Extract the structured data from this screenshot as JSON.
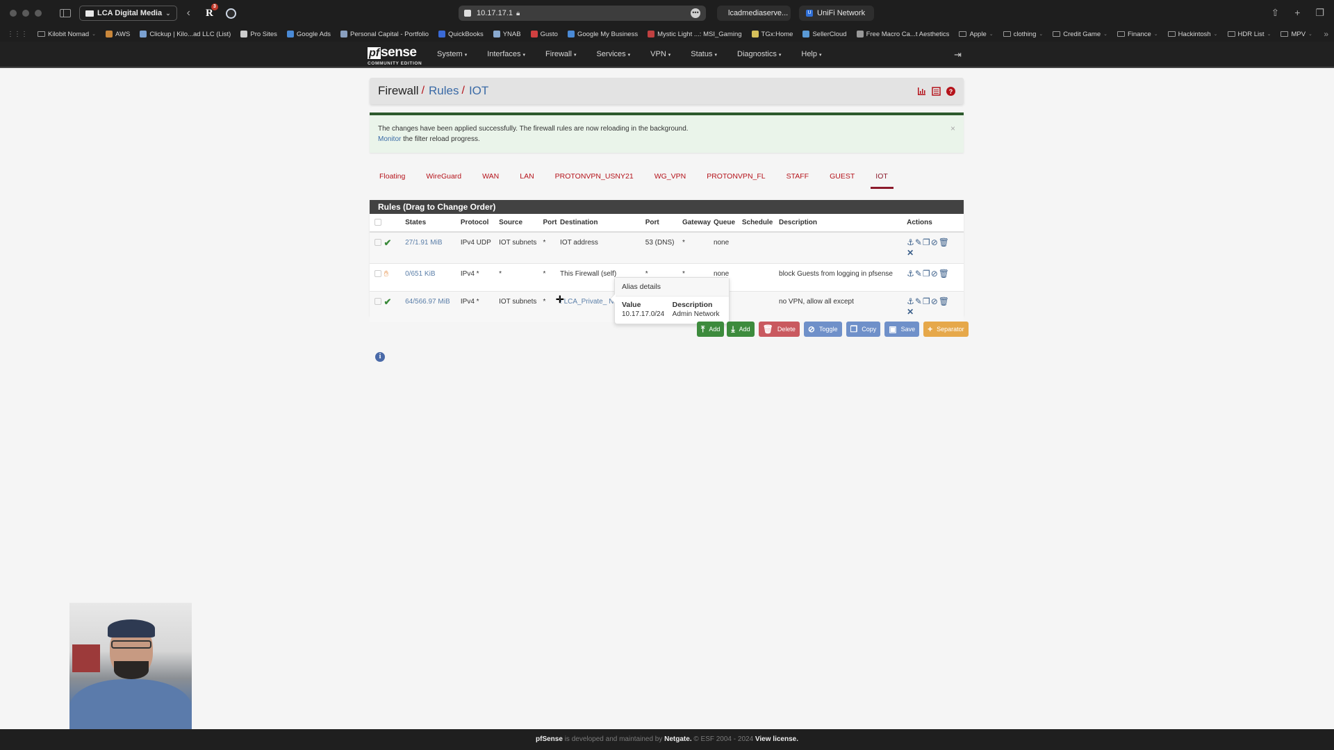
{
  "browser": {
    "profile": "LCA Digital Media",
    "ext_badge": "3",
    "url": "10.17.17.1",
    "tabs": [
      "lcadmediaserve...",
      "UniFi Network"
    ],
    "bookmarks": [
      {
        "label": "Kilobit Nomad",
        "folder": true
      },
      {
        "label": "AWS",
        "folder": false
      },
      {
        "label": "Clickup | Kilo...ad LLC (List)",
        "folder": false
      },
      {
        "label": "Pro Sites",
        "folder": false
      },
      {
        "label": "Google Ads",
        "folder": false
      },
      {
        "label": "Personal Capital - Portfolio",
        "folder": false
      },
      {
        "label": "QuickBooks",
        "folder": false
      },
      {
        "label": "YNAB",
        "folder": false
      },
      {
        "label": "Gusto",
        "folder": false
      },
      {
        "label": "Google My Business",
        "folder": false
      },
      {
        "label": "Mystic Light ...: MSI_Gaming",
        "folder": false
      },
      {
        "label": "TGx:Home",
        "folder": false
      },
      {
        "label": "SellerCloud",
        "folder": false
      },
      {
        "label": "Free Macro Ca...t Aesthetics",
        "folder": false
      },
      {
        "label": "Apple",
        "folder": true
      },
      {
        "label": "clothing",
        "folder": true
      },
      {
        "label": "Credit Game",
        "folder": true
      },
      {
        "label": "Finance",
        "folder": true
      },
      {
        "label": "Hackintosh",
        "folder": true
      },
      {
        "label": "HDR List",
        "folder": true
      },
      {
        "label": "MPV",
        "folder": true
      }
    ]
  },
  "nav": {
    "logo_pf": "pf",
    "logo_sense": "sense",
    "logo_edition": "COMMUNITY EDITION",
    "menu": [
      "System",
      "Interfaces",
      "Firewall",
      "Services",
      "VPN",
      "Status",
      "Diagnostics",
      "Help"
    ]
  },
  "breadcrumb": {
    "items": [
      "Firewall",
      "Rules",
      "IOT"
    ]
  },
  "alert": {
    "message": "The changes have been applied successfully. The firewall rules are now reloading in the background.",
    "link": "Monitor",
    "link_suffix": " the filter reload progress.",
    "close": "×"
  },
  "tabs": {
    "items": [
      "Floating",
      "WireGuard",
      "WAN",
      "LAN",
      "PROTONVPN_USNY21",
      "WG_VPN",
      "PROTONVPN_FL",
      "STAFF",
      "GUEST",
      "IOT"
    ],
    "active": "IOT"
  },
  "rules": {
    "title": "Rules (Drag to Change Order)",
    "columns": [
      "",
      "",
      "States",
      "Protocol",
      "Source",
      "Port",
      "Destination",
      "Port",
      "Gateway",
      "Queue",
      "Schedule",
      "Description",
      "Actions"
    ],
    "rows": [
      {
        "status": "pass",
        "states": "27/1.91 MiB",
        "protocol": "IPv4 UDP",
        "source": "IOT subnets",
        "src_port": "*",
        "destination": "IOT address",
        "dst_port": "53 (DNS)",
        "gateway": "*",
        "queue": "none",
        "schedule": "",
        "description": ""
      },
      {
        "status": "block",
        "states": "0/651 KiB",
        "protocol": "IPv4 *",
        "source": "*",
        "src_port": "*",
        "destination": "This Firewall (self)",
        "dst_port": "*",
        "gateway": "*",
        "queue": "none",
        "schedule": "",
        "description": "block Guests from logging in pfsense"
      },
      {
        "status": "pass",
        "states": "64/566.97 MiB",
        "protocol": "IPv4 *",
        "source": "IOT subnets",
        "src_port": "*",
        "destination": "! LCA_Private_ Networks",
        "dst_port": "",
        "gateway": "",
        "queue": "",
        "schedule": "",
        "description": "no VPN, allow all except"
      }
    ]
  },
  "tooltip": {
    "title": "Alias details",
    "value_header": "Value",
    "desc_header": "Description",
    "value": "10.17.17.0/24",
    "description": "Admin Network"
  },
  "buttons": {
    "add_top": "Add",
    "add_bottom": "Add",
    "delete": "Delete",
    "toggle": "Toggle",
    "copy": "Copy",
    "save": "Save",
    "separator": "Separator"
  },
  "footer": {
    "brand": "pfSense",
    "text1": " is developed and maintained by ",
    "company": "Netgate.",
    "text2": " © ESF 2004 - 2024 ",
    "license": "View license."
  }
}
